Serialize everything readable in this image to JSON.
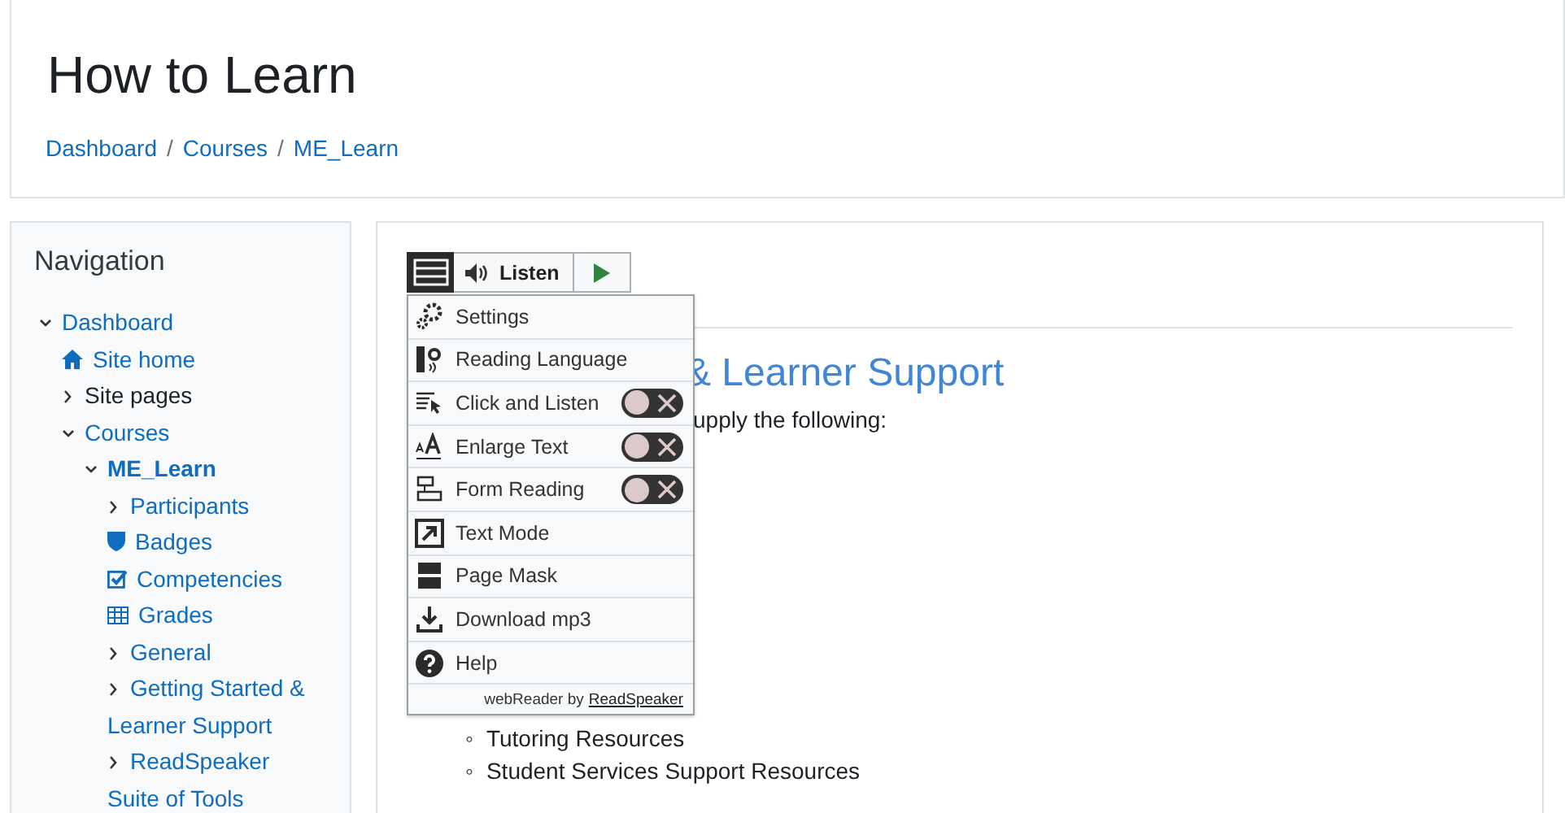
{
  "header": {
    "title": "How to Learn",
    "breadcrumb": [
      {
        "label": "Dashboard",
        "separator": "/"
      },
      {
        "label": "Courses",
        "separator": "/"
      },
      {
        "label": "ME_Learn"
      }
    ]
  },
  "navigation": {
    "title": "Navigation",
    "items": [
      {
        "label": "Dashboard",
        "kind": "branch",
        "expanded": true,
        "link": true,
        "current": false,
        "children": [
          {
            "label": "Site home",
            "kind": "home",
            "link": true,
            "current": false
          },
          {
            "label": "Site pages",
            "kind": "branch",
            "expanded": false,
            "link": false,
            "current": false
          },
          {
            "label": "Courses",
            "kind": "branch",
            "expanded": true,
            "link": true,
            "current": false,
            "children": [
              {
                "label": "ME_Learn",
                "kind": "branch",
                "expanded": true,
                "link": true,
                "current": true,
                "children": [
                  {
                    "label": "Participants",
                    "kind": "branch",
                    "expanded": false,
                    "link": true,
                    "current": false
                  },
                  {
                    "label": "Badges",
                    "kind": "badge",
                    "link": true,
                    "current": false
                  },
                  {
                    "label": "Competencies",
                    "kind": "competency",
                    "link": true,
                    "current": false
                  },
                  {
                    "label": "Grades",
                    "kind": "grades",
                    "link": true,
                    "current": false
                  },
                  {
                    "label": "General",
                    "kind": "branch",
                    "expanded": false,
                    "link": true,
                    "current": false
                  },
                  {
                    "label": "Getting Started & Learner Support",
                    "kind": "branch",
                    "expanded": false,
                    "link": true,
                    "current": false
                  },
                  {
                    "label": "ReadSpeaker Suite of Tools",
                    "kind": "branch",
                    "expanded": false,
                    "link": true,
                    "current": false
                  }
                ]
              }
            ]
          }
        ]
      }
    ]
  },
  "readspeaker": {
    "listen": "Listen",
    "menu": [
      {
        "label": "Settings",
        "kind": "settings"
      },
      {
        "label": "Reading Language",
        "kind": "language"
      },
      {
        "label": "Click and Listen",
        "kind": "click",
        "on": false
      },
      {
        "label": "Enlarge Text",
        "kind": "enlarge",
        "on": false
      },
      {
        "label": "Form Reading",
        "kind": "form",
        "on": false
      },
      {
        "label": "Text Mode",
        "kind": "textmode"
      },
      {
        "label": "Page Mask",
        "kind": "mask"
      },
      {
        "label": "Download mp3",
        "kind": "download"
      },
      {
        "label": "Help",
        "kind": "help"
      }
    ],
    "footer": {
      "text": "webReader by",
      "link": "ReadSpeaker"
    }
  },
  "content": {
    "heading": "& Learner Support",
    "intro": "upply the following:",
    "list": [
      {
        "marker": "◦",
        "text": "Tutoring Resources"
      },
      {
        "marker": "◦",
        "text": "Student Services Support Resources"
      }
    ]
  }
}
